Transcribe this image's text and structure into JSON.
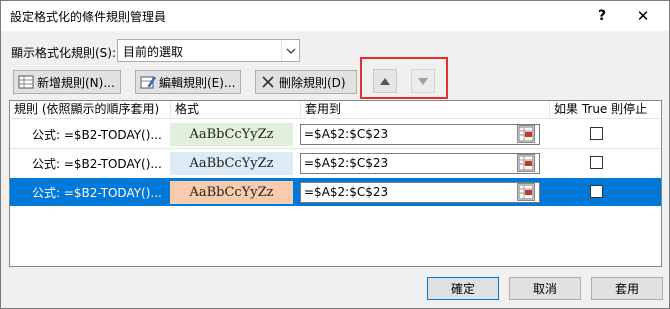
{
  "window": {
    "title": "設定格式化的條件規則管理員",
    "help": "?",
    "close": "✕"
  },
  "scope": {
    "label": "顯示格式化規則(S):",
    "selected": "目前的選取"
  },
  "toolbar": {
    "new_label": "新增規則(N)...",
    "edit_label": "編輯規則(E)...",
    "delete_label": "刪除規則(D)"
  },
  "columns": {
    "rule": "規則 (依照顯示的順序套用)",
    "format": "格式",
    "applies_to": "套用到",
    "stop_if_true": "如果 True 則停止"
  },
  "rules": [
    {
      "rule": "公式: =$B2-TODAY()...",
      "preview": "AaBbCcYyZz",
      "fill": "#e2efda",
      "applies_to": "=$A$2:$C$23",
      "stop_if_true": false,
      "selected": false
    },
    {
      "rule": "公式: =$B2-TODAY()...",
      "preview": "AaBbCcYyZz",
      "fill": "#ddebf7",
      "applies_to": "=$A$2:$C$23",
      "stop_if_true": false,
      "selected": false
    },
    {
      "rule": "公式: =$B2-TODAY()...",
      "preview": "AaBbCcYyZz",
      "fill": "#f8cbad",
      "applies_to": "=$A$2:$C$23",
      "stop_if_true": false,
      "selected": true
    }
  ],
  "buttons": {
    "ok": "確定",
    "cancel": "取消",
    "apply": "套用"
  },
  "colors": {
    "selection": "#0078d7",
    "highlight_box": "#e03030"
  }
}
